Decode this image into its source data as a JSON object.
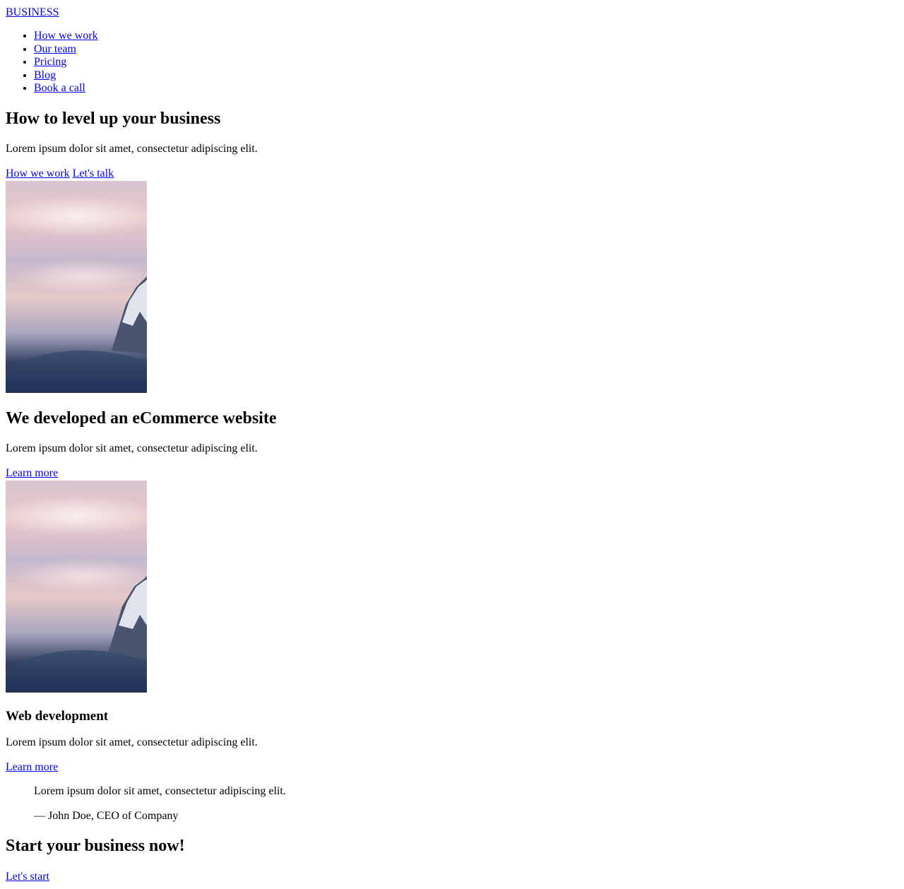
{
  "header": {
    "brand": "BUSINESS",
    "nav": [
      "How we work",
      "Our team",
      "Pricing",
      "Blog",
      "Book a call"
    ]
  },
  "hero": {
    "title": "How to level up your business",
    "text": "Lorem ipsum dolor sit amet, consectetur adipiscing elit.",
    "primary_link": "How we work",
    "secondary_link": "Let's talk"
  },
  "case_study": {
    "title": "We developed an eCommerce website",
    "text": "Lorem ipsum dolor sit amet, consectetur adipiscing elit.",
    "link": "Learn more"
  },
  "service": {
    "title": "Web development",
    "text": "Lorem ipsum dolor sit amet, consectetur adipiscing elit.",
    "link": "Learn more"
  },
  "testimonial": {
    "quote": "Lorem ipsum dolor sit amet, consectetur adipiscing elit.",
    "author": "— John Doe, CEO of Company"
  },
  "cta": {
    "title": "Start your business now!",
    "link": "Let's start"
  },
  "theme": {
    "link_color": "#0000ee",
    "text_color": "#000000",
    "background": "#ffffff"
  }
}
